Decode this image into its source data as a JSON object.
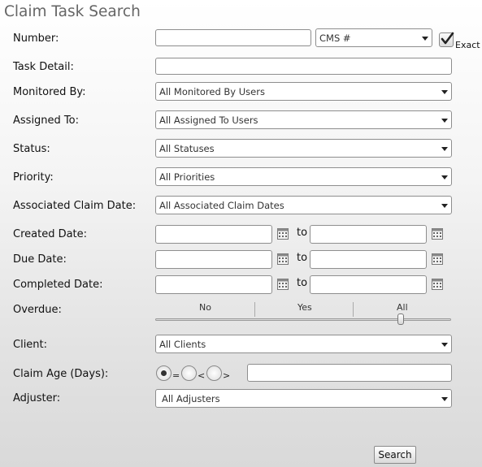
{
  "title": "Claim Task Search",
  "labels": {
    "number": "Number:",
    "task_detail": "Task Detail:",
    "monitored_by": "Monitored By:",
    "assigned_to": "Assigned To:",
    "status": "Status:",
    "priority": "Priority:",
    "associated_claim_date": "Associated Claim Date:",
    "created_date": "Created Date:",
    "due_date": "Due Date:",
    "completed_date": "Completed Date:",
    "overdue": "Overdue:",
    "client": "Client:",
    "claim_age": "Claim Age (Days):",
    "adjuster": "Adjuster:"
  },
  "number": {
    "value": "",
    "type_select": "CMS #",
    "exact_label": "Exact",
    "exact_checked": true
  },
  "task_detail": {
    "value": ""
  },
  "selects": {
    "monitored_by": "All Monitored By Users",
    "assigned_to": "All Assigned To Users",
    "status": "All Statuses",
    "priority": "All Priorities",
    "associated_claim_date": "All Associated Claim Dates",
    "client": "All Clients",
    "adjuster": "All Adjusters"
  },
  "range_separator": "to",
  "dates": {
    "created_from": "",
    "created_to": "",
    "due_from": "",
    "due_to": "",
    "completed_from": "",
    "completed_to": ""
  },
  "overdue": {
    "options": [
      "No",
      "Yes",
      "All"
    ],
    "selected": "All"
  },
  "claim_age": {
    "operators": [
      "=",
      "<",
      ">"
    ],
    "selected": "=",
    "value": ""
  },
  "search_button": "Search",
  "icons": {
    "calendar": "calendar-icon",
    "checkmark": "checkmark-icon",
    "caret": "chevron-down-icon"
  }
}
